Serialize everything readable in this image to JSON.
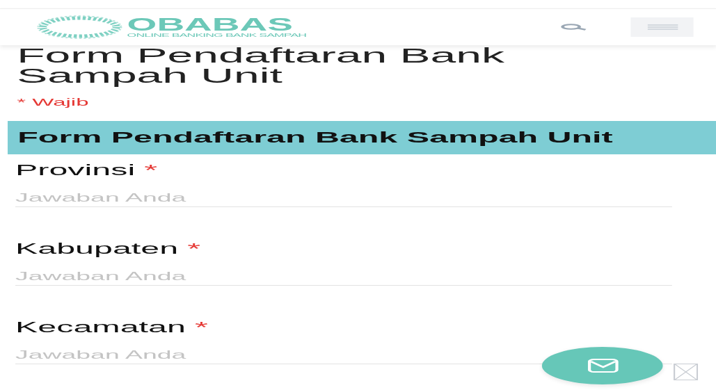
{
  "header": {
    "logo_title": "OBABAS",
    "logo_subtitle": "ONLINE BANKING BANK SAMPAH"
  },
  "form": {
    "title": "Form Pendaftaran Bank Sampah Unit",
    "required_note": "* Wajib",
    "section_title": "Form Pendaftaran Bank Sampah Unit",
    "fields": [
      {
        "label": "Provinsi",
        "required_mark": "*",
        "placeholder": "Jawaban Anda"
      },
      {
        "label": "Kabupaten",
        "required_mark": "*",
        "placeholder": "Jawaban Anda"
      },
      {
        "label": "Kecamatan",
        "required_mark": "*",
        "placeholder": "Jawaban Anda"
      }
    ]
  }
}
